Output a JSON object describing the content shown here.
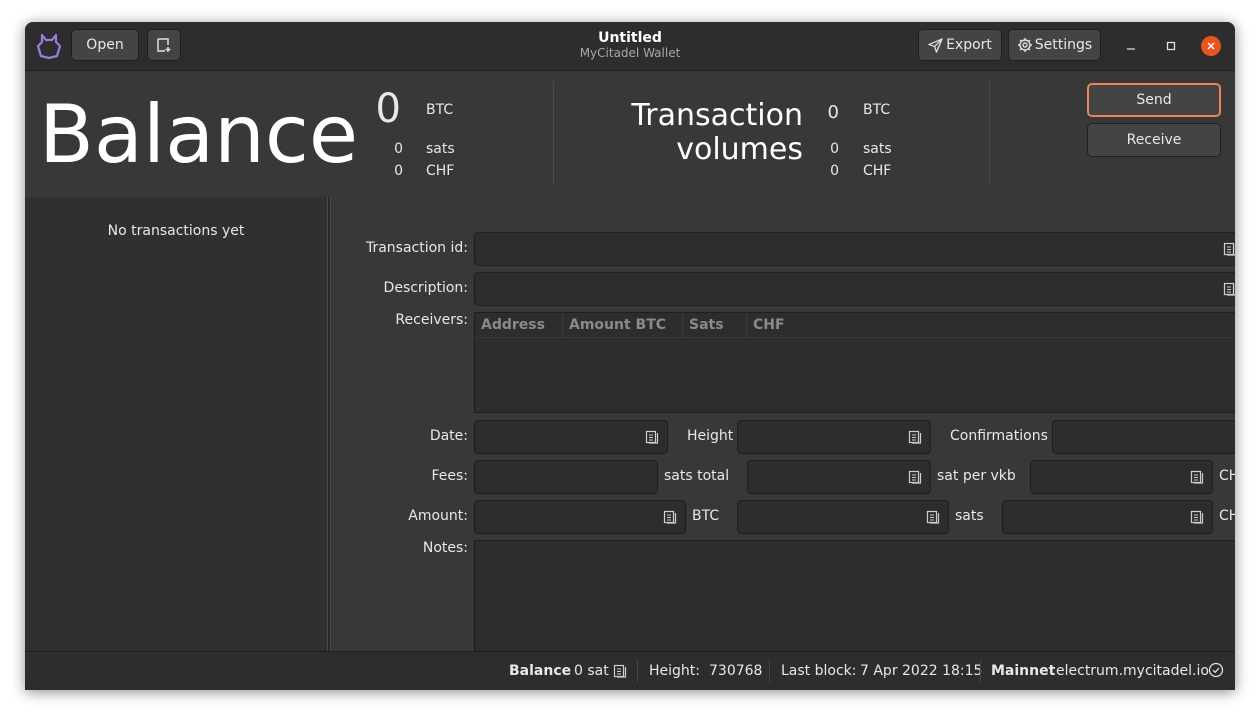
{
  "window": {
    "title": "Untitled",
    "subtitle": "MyCitadel Wallet",
    "open_label": "Open",
    "export_label": "Export",
    "settings_label": "Settings"
  },
  "balance": {
    "heading": "Balance",
    "btc_value": "0",
    "btc_unit": "BTC",
    "sats_value": "0",
    "sats_unit": "sats",
    "fiat_value": "0",
    "fiat_unit": "CHF"
  },
  "volumes": {
    "heading_line1": "Transaction",
    "heading_line2": "volumes",
    "btc_value": "0",
    "btc_unit": "BTC",
    "sats_value": "0",
    "sats_unit": "sats",
    "fiat_value": "0",
    "fiat_unit": "CHF"
  },
  "actions": {
    "send_label": "Send",
    "receive_label": "Receive"
  },
  "tx_list": {
    "empty_text": "No transactions yet"
  },
  "details": {
    "txid_label": "Transaction id:",
    "txid_value": "",
    "description_label": "Description:",
    "description_value": "",
    "receivers_label": "Receivers:",
    "receivers_columns": [
      "Address",
      "Amount BTC",
      "Sats",
      "CHF"
    ],
    "date_label": "Date:",
    "date_value": "",
    "height_label": "Height",
    "height_value": "",
    "confirmations_label": "Confirmations",
    "confirmations_value": "",
    "fees_label": "Fees:",
    "fees_sats_total_unit": "sats total",
    "fees_sat_per_vkb_unit": "sat per vkb",
    "fees_chf_unit": "CHF",
    "amount_label": "Amount:",
    "amount_btc_unit": "BTC",
    "amount_sats_unit": "sats",
    "amount_chf_unit": "CHF",
    "notes_label": "Notes:",
    "notes_value": ""
  },
  "statusbar": {
    "balance_label": "Balance",
    "balance_value": "0 sat",
    "height_label": "Height:",
    "height_value": "730768",
    "last_block_label": "Last block:",
    "last_block_value": "7 Apr 2022 18:15",
    "network_label": "Mainnet",
    "server": "electrum.mycitadel.io"
  },
  "colors": {
    "background": "#383838",
    "headerbar": "#2d2d2d",
    "list_background": "#303030",
    "field_background": "#2d2d2d",
    "accent_close": "#e95420",
    "focus_border": "#e9845e",
    "logo": "#9b7de2"
  },
  "icons": {
    "logo": "citadel-logo-icon",
    "new_wallet": "new-document-icon",
    "export": "send-arrow-icon",
    "settings": "gear-icon",
    "copy": "copy-icon",
    "connected": "check-circle-icon"
  }
}
